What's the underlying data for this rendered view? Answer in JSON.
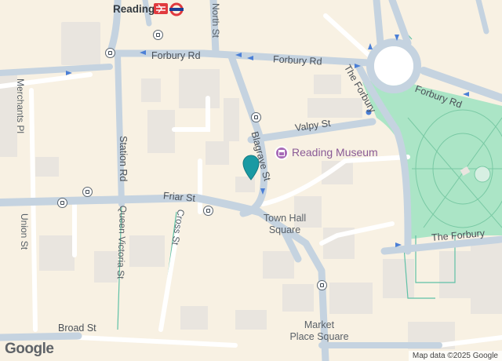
{
  "map": {
    "station": {
      "name": "Reading",
      "icons": [
        "national-rail-icon",
        "underground-icon"
      ]
    },
    "streets": {
      "forbury_rd_west": "Forbury Rd",
      "forbury_rd_east": "Forbury Rd",
      "forbury_rd_roundabout": "Forbury Rd",
      "north_st": "North St",
      "the_forbury_north": "The Forbury",
      "the_forbury_south": "The Forbury",
      "merchants_pl": "Merchants Pl",
      "station_rd": "Station Rd",
      "valpy_st": "Valpy St",
      "blagrave_st": "Blagrave St",
      "friar_st": "Friar St",
      "cross_st": "Cross St",
      "union_st": "Union St",
      "queen_victoria_st": "Queen Victoria St",
      "broad_st": "Broad St"
    },
    "poi": {
      "museum": "Reading Museum"
    },
    "places": {
      "town_hall_square_1": "Town Hall",
      "town_hall_square_2": "Square",
      "market_place_1": "Market",
      "market_place_2": "Place Square"
    },
    "colors": {
      "background": "#f8f1e3",
      "road": "#c5d3e0",
      "building": "#e9e5df",
      "park": "#abe5c6",
      "marker": "#1a9aa3",
      "poi": "#8a5a96"
    },
    "marker": {
      "icon": "location-pin-icon"
    },
    "branding": {
      "logo": "Google"
    },
    "attribution": "Map data ©2025 Google"
  }
}
